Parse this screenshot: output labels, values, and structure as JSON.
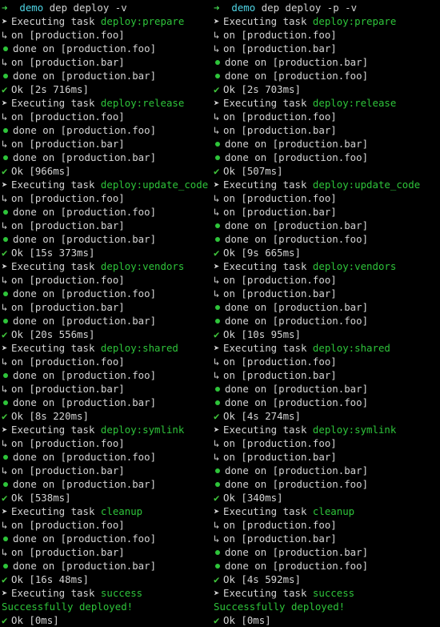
{
  "colors": {
    "background": "#000000",
    "text": "#d4d4d4",
    "green": "#2ec43a",
    "cyan": "#4fd6e6"
  },
  "panes": [
    {
      "prompt": {
        "dir": "demo",
        "command": "dep deploy -v"
      },
      "lines": [
        {
          "type": "exec",
          "prefix": "Executing task ",
          "task": "deploy:prepare"
        },
        {
          "type": "on",
          "text": "on [production.foo]"
        },
        {
          "type": "done",
          "text": "done on [production.foo]"
        },
        {
          "type": "on",
          "text": "on [production.bar]"
        },
        {
          "type": "done",
          "text": "done on [production.bar]"
        },
        {
          "type": "ok",
          "text": "Ok [2s 716ms]"
        },
        {
          "type": "exec",
          "prefix": "Executing task ",
          "task": "deploy:release"
        },
        {
          "type": "on",
          "text": "on [production.foo]"
        },
        {
          "type": "done",
          "text": "done on [production.foo]"
        },
        {
          "type": "on",
          "text": "on [production.bar]"
        },
        {
          "type": "done",
          "text": "done on [production.bar]"
        },
        {
          "type": "ok",
          "text": "Ok [966ms]"
        },
        {
          "type": "exec",
          "prefix": "Executing task ",
          "task": "deploy:update_code"
        },
        {
          "type": "on",
          "text": "on [production.foo]"
        },
        {
          "type": "done",
          "text": "done on [production.foo]"
        },
        {
          "type": "on",
          "text": "on [production.bar]"
        },
        {
          "type": "done",
          "text": "done on [production.bar]"
        },
        {
          "type": "ok",
          "text": "Ok [15s 373ms]"
        },
        {
          "type": "exec",
          "prefix": "Executing task ",
          "task": "deploy:vendors"
        },
        {
          "type": "on",
          "text": "on [production.foo]"
        },
        {
          "type": "done",
          "text": "done on [production.foo]"
        },
        {
          "type": "on",
          "text": "on [production.bar]"
        },
        {
          "type": "done",
          "text": "done on [production.bar]"
        },
        {
          "type": "ok",
          "text": "Ok [20s 556ms]"
        },
        {
          "type": "exec",
          "prefix": "Executing task ",
          "task": "deploy:shared"
        },
        {
          "type": "on",
          "text": "on [production.foo]"
        },
        {
          "type": "done",
          "text": "done on [production.foo]"
        },
        {
          "type": "on",
          "text": "on [production.bar]"
        },
        {
          "type": "done",
          "text": "done on [production.bar]"
        },
        {
          "type": "ok",
          "text": "Ok [8s 220ms]"
        },
        {
          "type": "exec",
          "prefix": "Executing task ",
          "task": "deploy:symlink"
        },
        {
          "type": "on",
          "text": "on [production.foo]"
        },
        {
          "type": "done",
          "text": "done on [production.foo]"
        },
        {
          "type": "on",
          "text": "on [production.bar]"
        },
        {
          "type": "done",
          "text": "done on [production.bar]"
        },
        {
          "type": "ok",
          "text": "Ok [538ms]"
        },
        {
          "type": "exec",
          "prefix": "Executing task ",
          "task": "cleanup"
        },
        {
          "type": "on",
          "text": "on [production.foo]"
        },
        {
          "type": "done",
          "text": "done on [production.foo]"
        },
        {
          "type": "on",
          "text": "on [production.bar]"
        },
        {
          "type": "done",
          "text": "done on [production.bar]"
        },
        {
          "type": "ok",
          "text": "Ok [16s 48ms]"
        },
        {
          "type": "exec",
          "prefix": "Executing task ",
          "task": "success"
        },
        {
          "type": "success",
          "text": "Successfully deployed!"
        },
        {
          "type": "ok",
          "text": "Ok [0ms]"
        }
      ]
    },
    {
      "prompt": {
        "dir": "demo",
        "command": "dep deploy -p -v"
      },
      "lines": [
        {
          "type": "exec",
          "prefix": "Executing task ",
          "task": "deploy:prepare"
        },
        {
          "type": "on",
          "text": "on [production.foo]"
        },
        {
          "type": "on",
          "text": "on [production.bar]"
        },
        {
          "type": "done",
          "text": "done on [production.bar]"
        },
        {
          "type": "done",
          "text": "done on [production.foo]"
        },
        {
          "type": "ok",
          "text": "Ok [2s 703ms]"
        },
        {
          "type": "exec",
          "prefix": "Executing task ",
          "task": "deploy:release"
        },
        {
          "type": "on",
          "text": "on [production.foo]"
        },
        {
          "type": "on",
          "text": "on [production.bar]"
        },
        {
          "type": "done",
          "text": "done on [production.bar]"
        },
        {
          "type": "done",
          "text": "done on [production.foo]"
        },
        {
          "type": "ok",
          "text": "Ok [507ms]"
        },
        {
          "type": "exec",
          "prefix": "Executing task ",
          "task": "deploy:update_code"
        },
        {
          "type": "on",
          "text": "on [production.foo]"
        },
        {
          "type": "on",
          "text": "on [production.bar]"
        },
        {
          "type": "done",
          "text": "done on [production.bar]"
        },
        {
          "type": "done",
          "text": "done on [production.foo]"
        },
        {
          "type": "ok",
          "text": "Ok [9s 665ms]"
        },
        {
          "type": "exec",
          "prefix": "Executing task ",
          "task": "deploy:vendors"
        },
        {
          "type": "on",
          "text": "on [production.foo]"
        },
        {
          "type": "on",
          "text": "on [production.bar]"
        },
        {
          "type": "done",
          "text": "done on [production.bar]"
        },
        {
          "type": "done",
          "text": "done on [production.foo]"
        },
        {
          "type": "ok",
          "text": "Ok [10s 95ms]"
        },
        {
          "type": "exec",
          "prefix": "Executing task ",
          "task": "deploy:shared"
        },
        {
          "type": "on",
          "text": "on [production.foo]"
        },
        {
          "type": "on",
          "text": "on [production.bar]"
        },
        {
          "type": "done",
          "text": "done on [production.bar]"
        },
        {
          "type": "done",
          "text": "done on [production.foo]"
        },
        {
          "type": "ok",
          "text": "Ok [4s 274ms]"
        },
        {
          "type": "exec",
          "prefix": "Executing task ",
          "task": "deploy:symlink"
        },
        {
          "type": "on",
          "text": "on [production.foo]"
        },
        {
          "type": "on",
          "text": "on [production.bar]"
        },
        {
          "type": "done",
          "text": "done on [production.bar]"
        },
        {
          "type": "done",
          "text": "done on [production.foo]"
        },
        {
          "type": "ok",
          "text": "Ok [340ms]"
        },
        {
          "type": "exec",
          "prefix": "Executing task ",
          "task": "cleanup"
        },
        {
          "type": "on",
          "text": "on [production.foo]"
        },
        {
          "type": "on",
          "text": "on [production.bar]"
        },
        {
          "type": "done",
          "text": "done on [production.bar]"
        },
        {
          "type": "done",
          "text": "done on [production.foo]"
        },
        {
          "type": "ok",
          "text": "Ok [4s 592ms]"
        },
        {
          "type": "exec",
          "prefix": "Executing task ",
          "task": "success"
        },
        {
          "type": "success",
          "text": "Successfully deployed!"
        },
        {
          "type": "ok",
          "text": "Ok [0ms]"
        }
      ]
    }
  ],
  "icons": {
    "prompt": "➜",
    "exec": "➤",
    "on": "↳",
    "ok": "✔"
  }
}
